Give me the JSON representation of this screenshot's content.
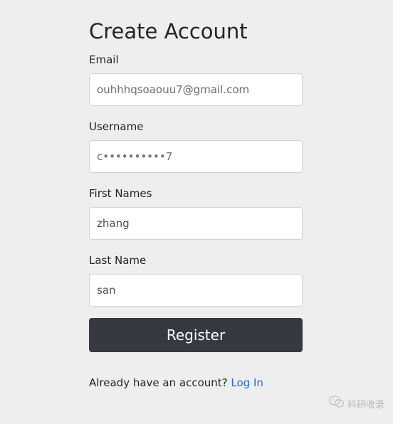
{
  "form": {
    "title": "Create Account",
    "email": {
      "label": "Email",
      "value": "ouhhhqsoaouu7@gmail.com"
    },
    "username": {
      "label": "Username",
      "value": "c••••••••••7"
    },
    "first_name": {
      "label": "First Names",
      "value": "zhang"
    },
    "last_name": {
      "label": "Last Name",
      "value": "san"
    },
    "register_label": "Register",
    "login_prompt": "Already have an account?",
    "login_link": "Log In"
  },
  "watermark": {
    "text": "科研收录",
    "icon": "wechat-logo-icon"
  },
  "colors": {
    "background": "#eeeeee",
    "button": "#343a40",
    "link": "#1a6fd8"
  }
}
